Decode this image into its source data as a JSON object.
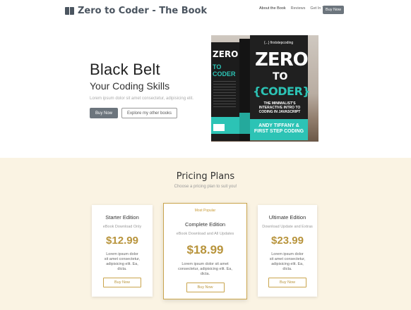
{
  "header": {
    "brand": "Zero to Coder - The Book",
    "nav": [
      "About the Book",
      "Reviews",
      "Get In Touch"
    ],
    "cta": "Buy Now"
  },
  "hero": {
    "title": "Black Belt",
    "subtitle": "Your Coding Skills",
    "text": "Lorem ipsum dolor sit amet consectetur, adipisicing elit.",
    "primary_button": "Buy Now",
    "secondary_button": "Explore my other books"
  },
  "book": {
    "logo": "{...} firststepcoding",
    "title_line1": "ZERO",
    "title_line2": "TO",
    "title_line3": "{CODER}",
    "subtitle": "THE MINIMALIST'S INTERACTIVE INTRO TO CODING IN JAVASCRIPT",
    "author": "ANDY TIFFANY & FIRST STEP CODING",
    "spine_title": "ZERO",
    "spine_sub": "TO CODER"
  },
  "pricing": {
    "title": "Pricing Plans",
    "subtitle": "Choose a pricing plan to suit you!",
    "plans": [
      {
        "name": "Starter Edition",
        "desc": "eBook Download Only",
        "price": "$12.99",
        "body1": "Lorem ipsum dolor",
        "body2": "sit amet consectetur,",
        "body3": "adipisicing elit. Ea,",
        "body4": "dicta.",
        "button": "Buy Now"
      },
      {
        "ribbon": "Most Popular",
        "name": "Complete Edition",
        "desc": "eBook Download and All Updates",
        "price": "$18.99",
        "body1": "Lorem ipsum dolor sit amet",
        "body2": "consectetur, adipisicing elit. Ea,",
        "body3": "dicta.",
        "button": "Buy Now"
      },
      {
        "name": "Ultimate Edition",
        "desc": "Download Update and Extras",
        "price": "$23.99",
        "body1": "Lorem ipsum dolor",
        "body2": "sit amet consectetur,",
        "body3": "adipisicing elit. Ea,",
        "body4": "dicta.",
        "button": "Buy Now"
      }
    ]
  }
}
